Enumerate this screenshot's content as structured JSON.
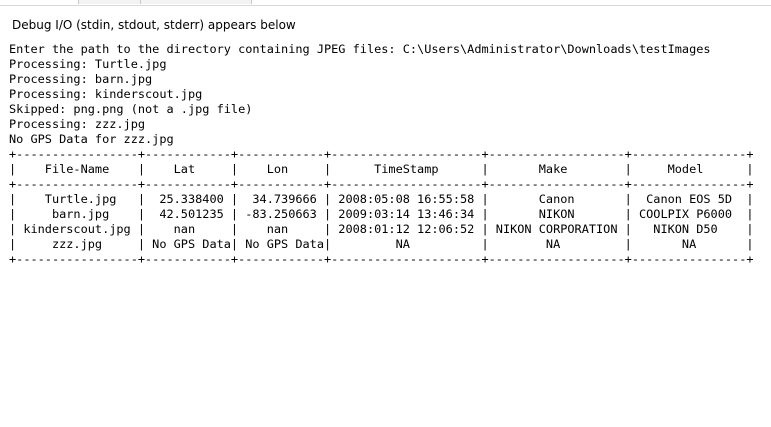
{
  "debug_panel": {
    "header": "Debug I/O (stdin, stdout, stderr) appears below"
  },
  "console": {
    "lines": [
      "Enter the path to the directory containing JPEG files: C:\\Users\\Administrator\\Downloads\\testImages",
      "Processing: Turtle.jpg",
      "Processing: barn.jpg",
      "Processing: kinderscout.jpg",
      "Skipped: png.png (not a .jpg file)",
      "Processing: zzz.jpg",
      "No GPS Data for zzz.jpg",
      "+-----------------+------------+------------+---------------------+-------------------+----------------+",
      "|    File-Name    |    Lat     |    Lon     |      TimeStamp      |       Make        |     Model      |",
      "+-----------------+------------+------------+---------------------+-------------------+----------------+",
      "|    Turtle.jpg   |  25.338400 |  34.739666 | 2008:05:08 16:55:58 |       Canon       |  Canon EOS 5D  |",
      "|     barn.jpg    |  42.501235 | -83.250663 | 2009:03:14 13:46:34 |       NIKON       | COOLPIX P6000  |",
      "| kinderscout.jpg |    nan     |    nan     | 2008:01:12 12:06:52 | NIKON CORPORATION |   NIKON D50    |",
      "|     zzz.jpg     | No GPS Data| No GPS Data|         NA          |        NA         |       NA       |",
      "+-----------------+------------+------------+---------------------+-------------------+----------------+"
    ]
  }
}
